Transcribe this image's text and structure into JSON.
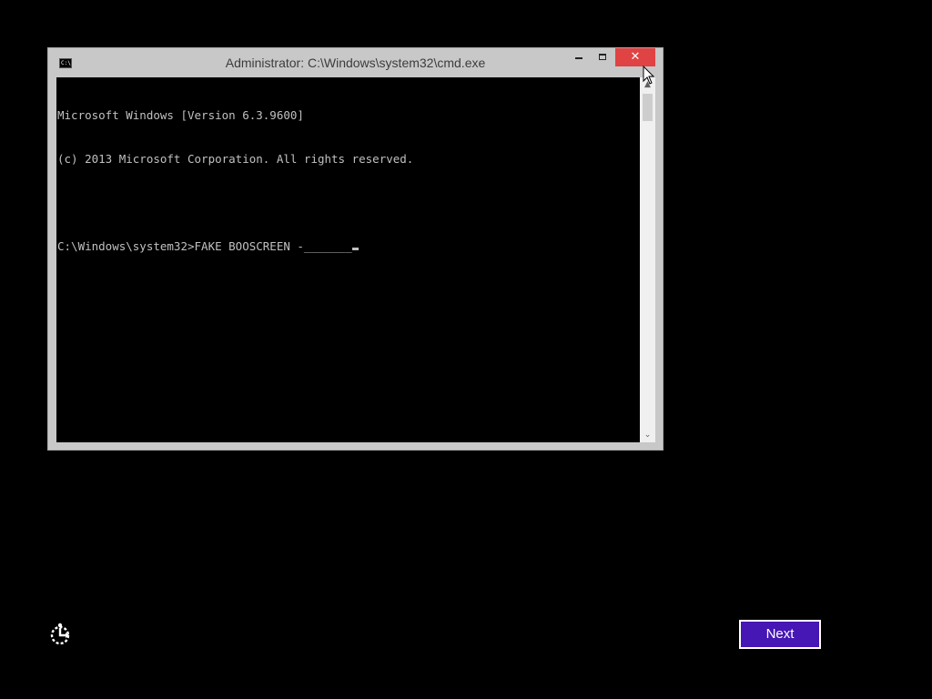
{
  "window": {
    "title": "Administrator: C:\\Windows\\system32\\cmd.exe",
    "icon": "cmd-icon",
    "icon_label": "C:\\.",
    "controls": {
      "minimize_icon": "minimize-icon",
      "maximize_icon": "maximize-icon",
      "close_icon": "close-icon",
      "close_glyph": "✕",
      "close_color": "#e04343"
    }
  },
  "console": {
    "lines": [
      "Microsoft Windows [Version 6.3.9600]",
      "(c) 2013 Microsoft Corporation. All rights reserved.",
      "",
      "C:\\Windows\\system32>FAKE BOOSCREEN -_______"
    ],
    "text_color": "#c0c0c0",
    "background_color": "#000000"
  },
  "scrollbar": {
    "up_glyph": "▲",
    "down_glyph": "⌄"
  },
  "footer": {
    "ease_of_access_icon": "ease-of-access-icon",
    "next_label": "Next",
    "next_color": "#4617b4"
  }
}
